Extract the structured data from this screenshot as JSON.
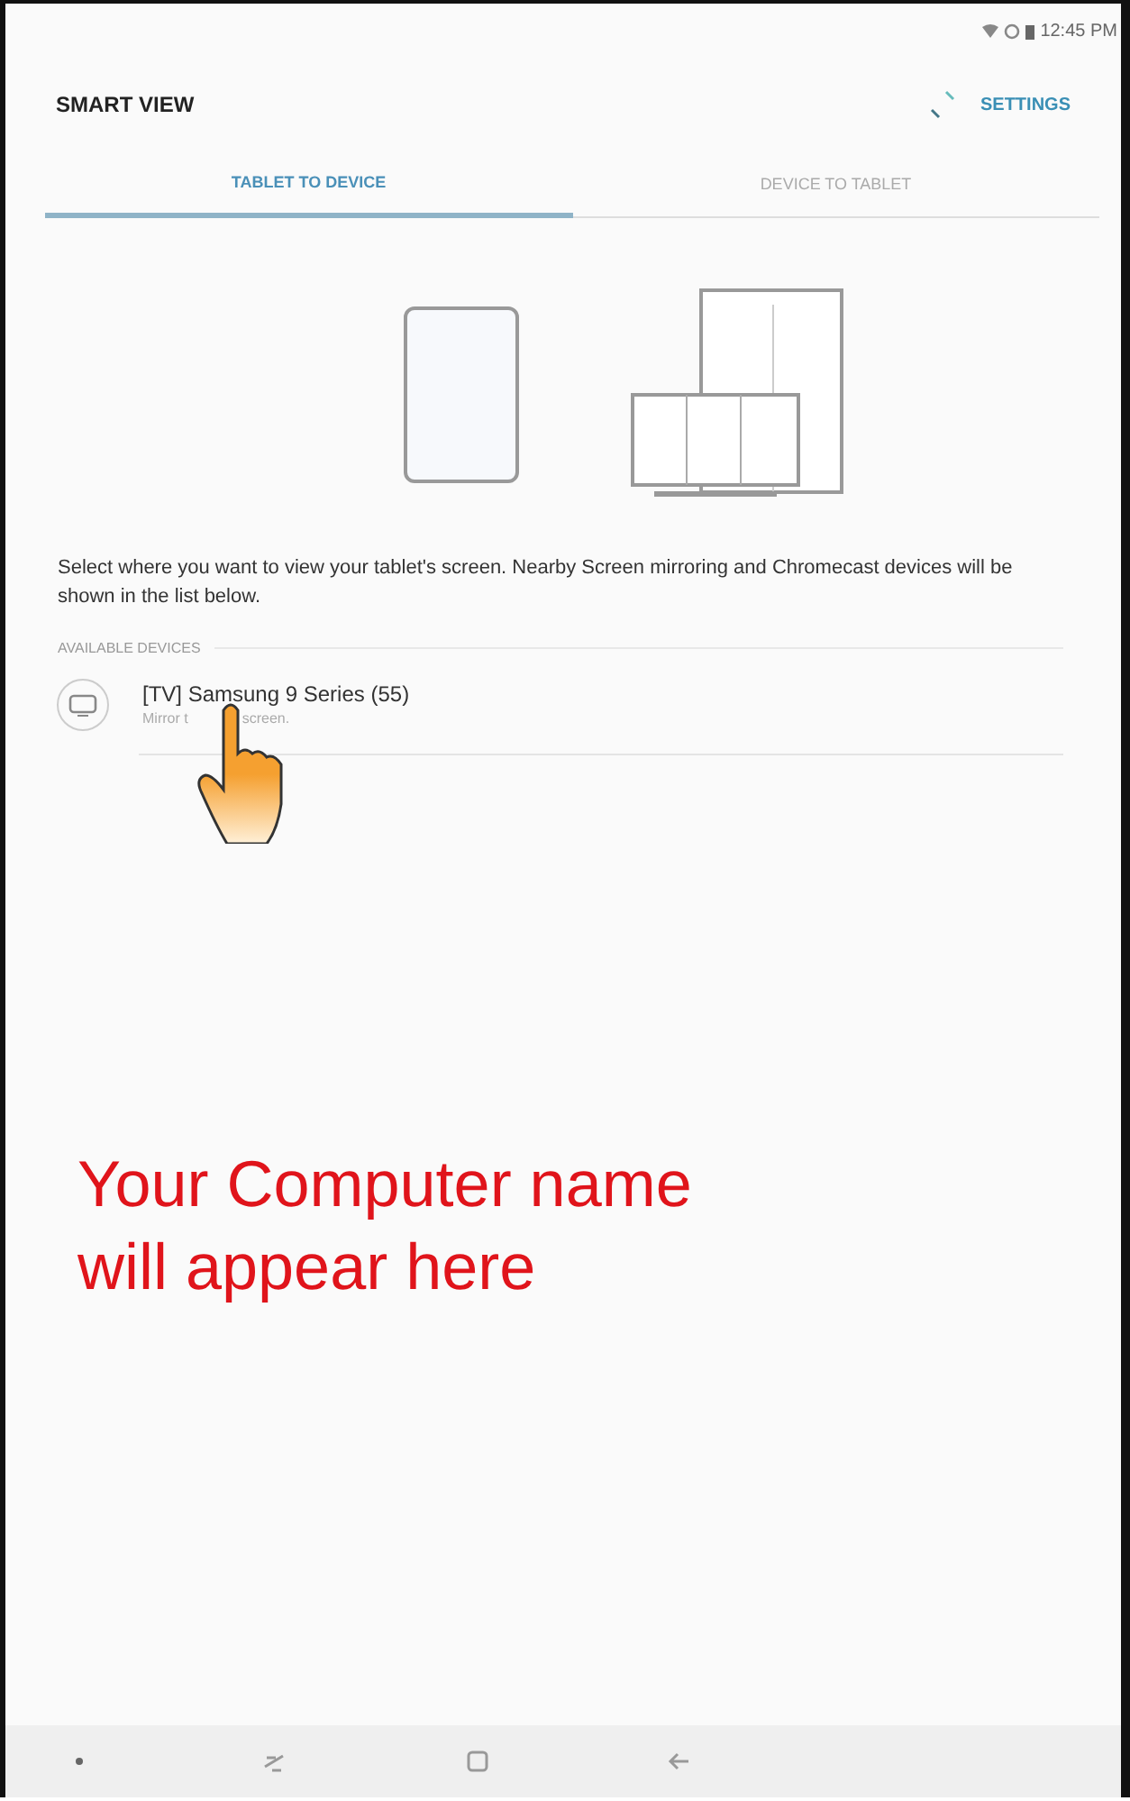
{
  "status_bar": {
    "time": "12:45 PM"
  },
  "header": {
    "title": "SMART VIEW",
    "settings": "SETTINGS"
  },
  "tabs": [
    {
      "label": "TABLET TO DEVICE",
      "selected": true
    },
    {
      "label": "DEVICE TO TABLET",
      "selected": false
    }
  ],
  "description": "Select where you want to view your tablet's screen. Nearby Screen mirroring and Chromecast devices will be shown in the list below.",
  "section_title": "AVAILABLE DEVICES",
  "devices": [
    {
      "name": "[TV] Samsung 9 Series (55)",
      "subtitle_parts": [
        "Mirror t",
        "screen."
      ]
    }
  ],
  "annotation": {
    "lines": [
      "Your Computer name",
      "will appear here"
    ]
  }
}
